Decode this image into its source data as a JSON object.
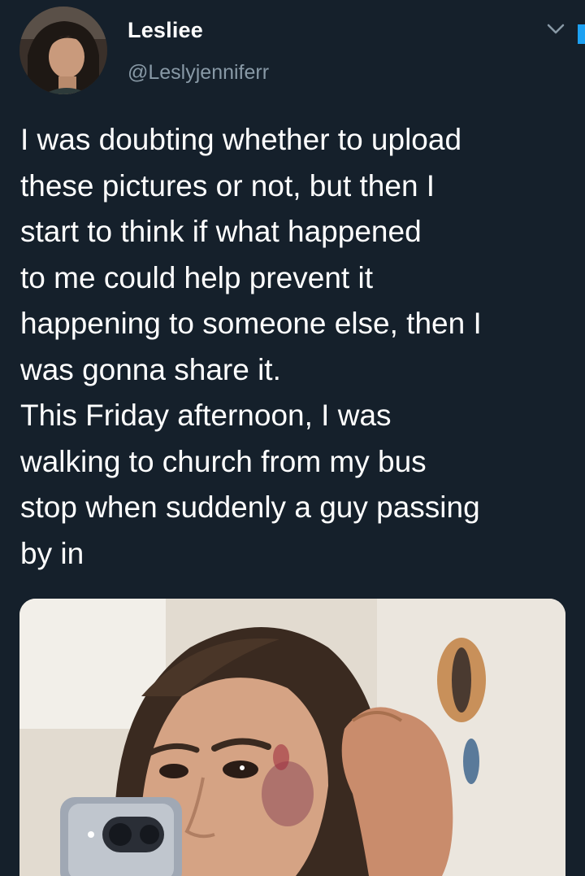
{
  "author": {
    "display_name": "Lesliee",
    "handle": "@Leslyjenniferr"
  },
  "tweet": {
    "text": "I was doubting whether to upload\nthese pictures or not, but then I\nstart to think if what happened\nto me could help prevent it\nhappening to someone else, then I\nwas gonna share it.\nThis Friday afternoon, I was\nwalking to church from my bus\nstop when suddenly a guy passing\nby in"
  },
  "icons": {
    "more": "chevron-down-icon"
  },
  "colors": {
    "background": "#15202b",
    "secondary_text": "#8899a6",
    "accent": "#1da1f2"
  }
}
